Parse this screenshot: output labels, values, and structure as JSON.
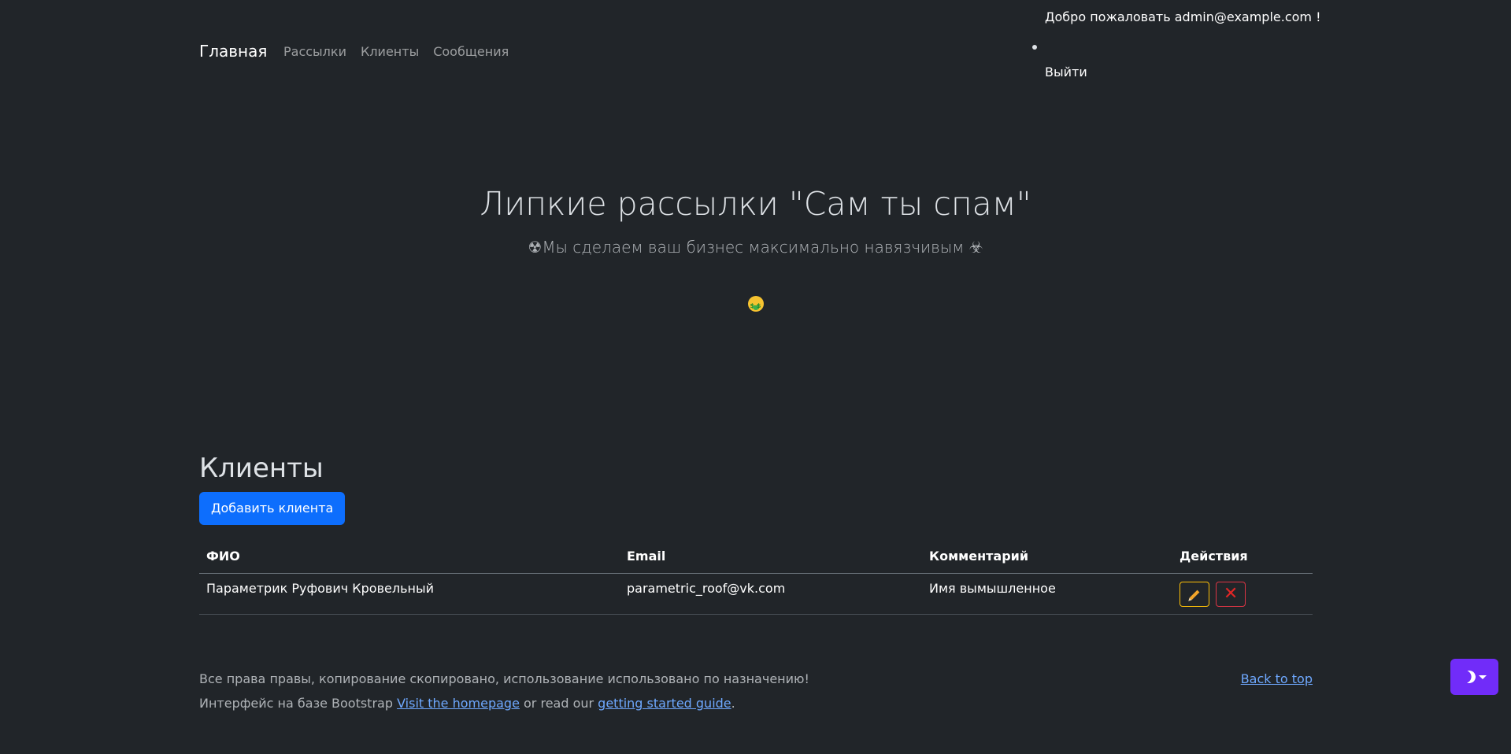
{
  "navbar": {
    "brand": "Главная",
    "items": [
      "Рассылки",
      "Клиенты",
      "Сообщения"
    ],
    "welcome": "Добро пожаловать admin@example.com !",
    "logout": "Выйти"
  },
  "hero": {
    "title": "Липкие рассылки \"Сам ты спам\"",
    "subtitle": "☢Мы сделаем ваш бизнес максимально навязчивым ☣",
    "emoji_icon": "money-mouth-face-icon"
  },
  "clients": {
    "title": "Клиенты",
    "add_button": "Добавить клиента",
    "columns": [
      "ФИО",
      "Email",
      "Комментарий",
      "Действия"
    ],
    "rows": [
      {
        "name": "Параметрик Руфович Кровельный",
        "email": "parametric_roof@vk.com",
        "comment": "Имя вымышленное",
        "actions": [
          "pencil-icon",
          "cross-icon"
        ]
      }
    ]
  },
  "footer": {
    "copyright": "Все права правы, копирование скопировано, использование использовано по назначению!",
    "line2_prefix": "Интерфейс на базе Bootstrap ",
    "homepage_link": "Visit the homepage",
    "line2_middle": " or read our ",
    "guide_link": "getting started guide",
    "line2_suffix": ".",
    "back_to_top": "Back to top"
  },
  "theme_toggle": {
    "icon": "moon-icon",
    "accent": "#712cf9"
  },
  "colors": {
    "background": "#212529",
    "primary": "#0d6efd",
    "link": "#6ea8fe",
    "warning": "#ffc107",
    "danger": "#dc3545"
  }
}
